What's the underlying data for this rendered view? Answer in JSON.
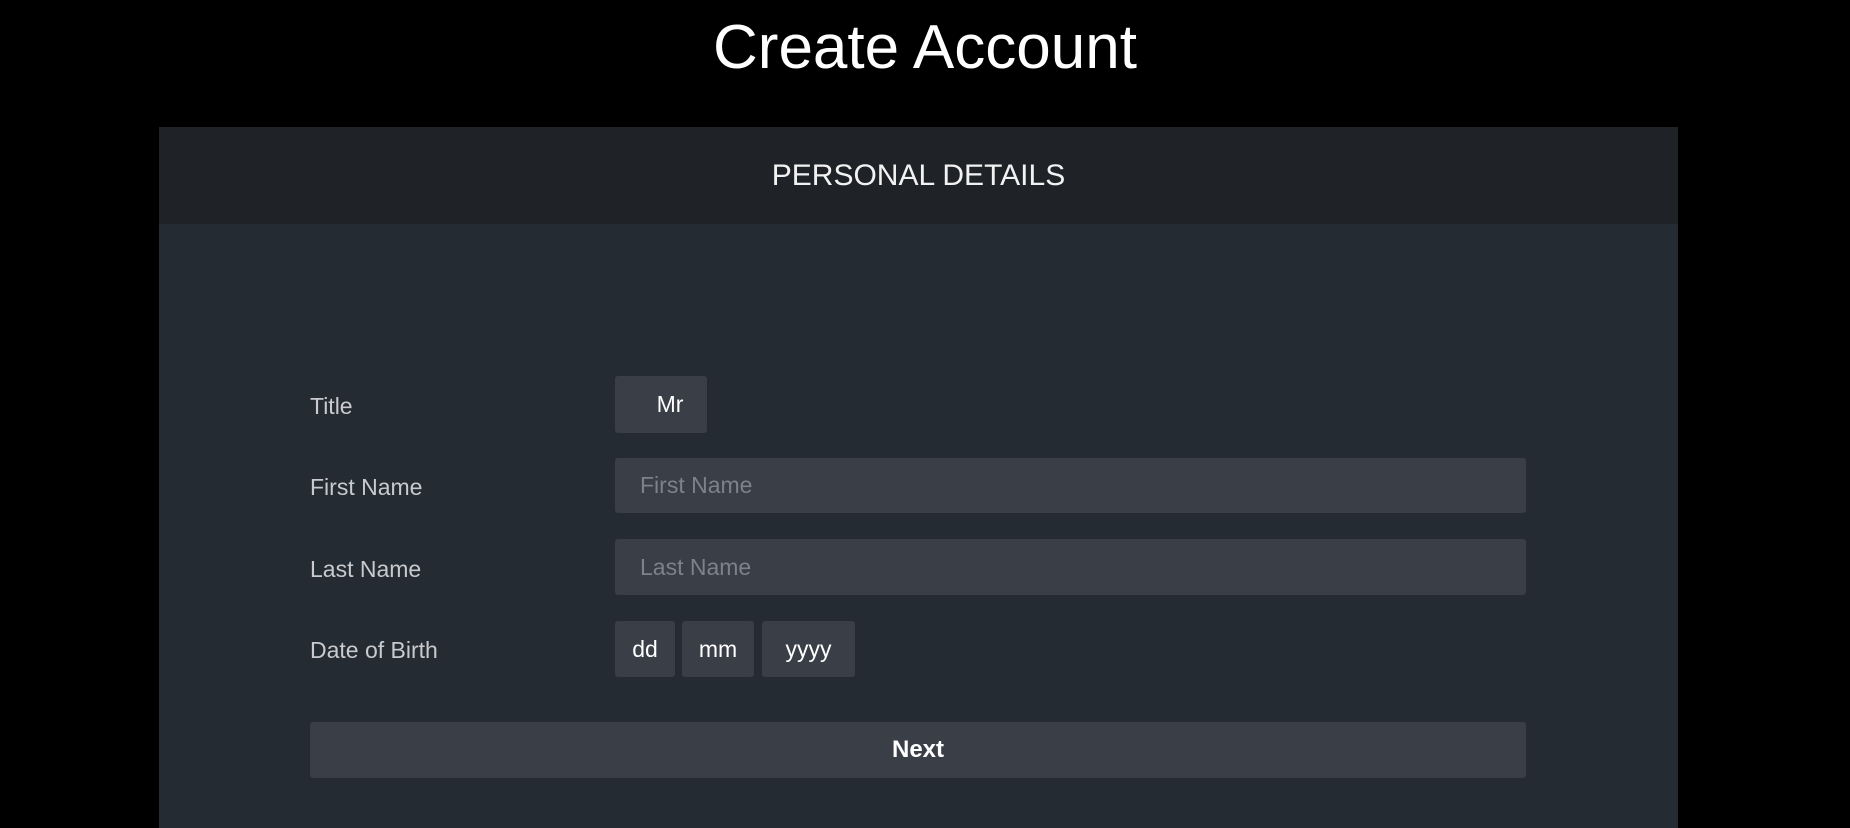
{
  "page": {
    "title": "Create Account"
  },
  "form": {
    "section_title": "PERSONAL DETAILS",
    "title_label": "Title",
    "title_value": "Mr",
    "first_name_label": "First Name",
    "first_name_placeholder": "First Name",
    "last_name_label": "Last Name",
    "last_name_placeholder": "Last Name",
    "dob_label": "Date of Birth",
    "dob_day_placeholder": "dd",
    "dob_month_placeholder": "mm",
    "dob_year_placeholder": "yyyy",
    "next_label": "Next"
  }
}
